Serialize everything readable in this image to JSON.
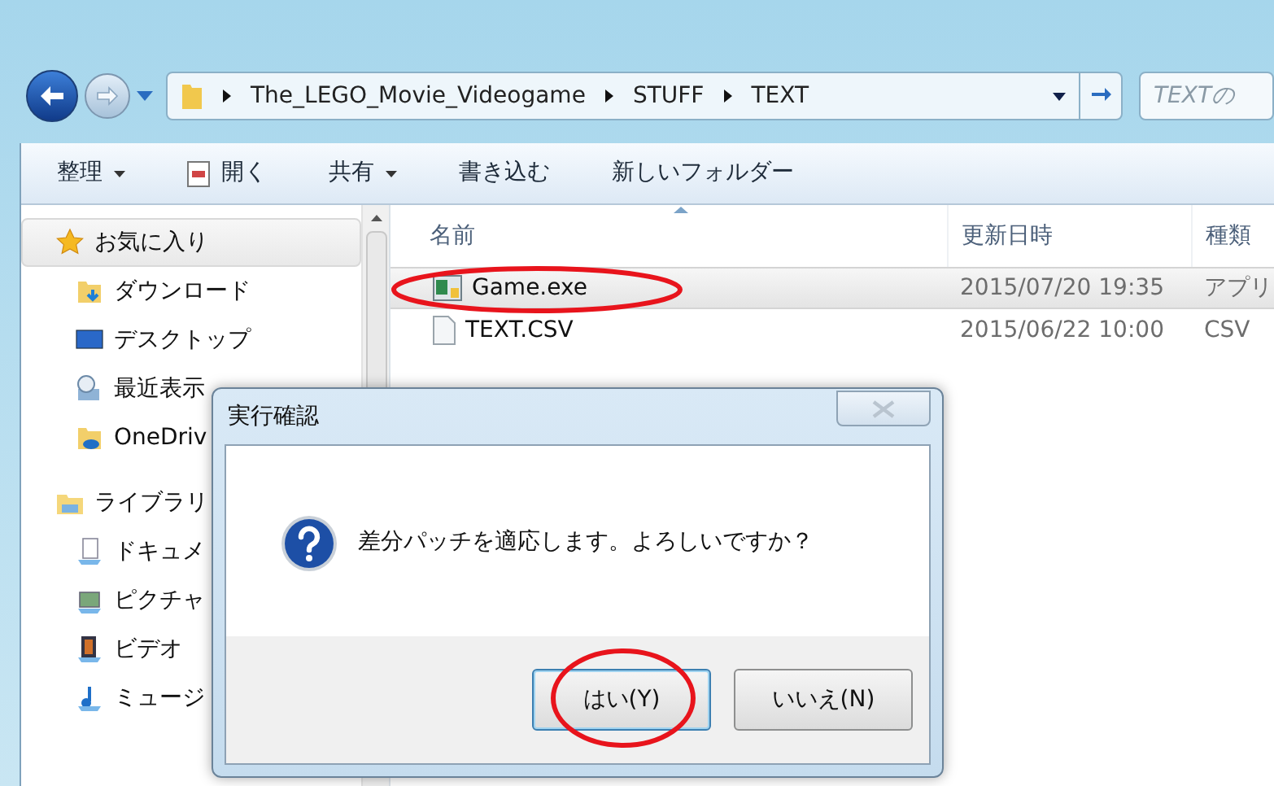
{
  "address_bar": {
    "path": [
      "The_LEGO_Movie_Videogame",
      "STUFF",
      "TEXT"
    ],
    "search": {
      "placeholder": "TEXTの"
    }
  },
  "toolbar": [
    {
      "label": "整理",
      "kind": "menu"
    },
    {
      "label": "開く",
      "kind": "icon"
    },
    {
      "label": "共有",
      "kind": "menu"
    },
    {
      "label": "書き込む",
      "kind": "plain"
    },
    {
      "label": "新しいフォルダー",
      "kind": "plain"
    }
  ],
  "sidebar": [
    {
      "label": "お気に入り",
      "kind": "star",
      "selected": true,
      "children": [
        {
          "label": "ダウンロード",
          "kind": "download",
          "selected": false
        },
        {
          "label": "デスクトップ",
          "kind": "desktop",
          "selected": false
        },
        {
          "label": "最近表示",
          "kind": "recent",
          "selected": false
        },
        {
          "label": "OneDriv",
          "kind": "cloud",
          "selected": false
        }
      ]
    },
    {
      "label": "ライブラリ",
      "kind": "library",
      "selected": false,
      "children": [
        {
          "label": "ドキュメ",
          "kind": "document",
          "selected": false
        },
        {
          "label": "ピクチャ",
          "kind": "pictures",
          "selected": false
        },
        {
          "label": "ビデオ",
          "kind": "video",
          "selected": false
        },
        {
          "label": "ミュージ",
          "kind": "music",
          "selected": false
        }
      ]
    }
  ],
  "file_list": {
    "columns": [
      "名前",
      "更新日時",
      "種類"
    ],
    "rows": [
      {
        "name": "Game.exe",
        "kind": "app",
        "modified": "2015/07/20 19:35",
        "type": "アプリ",
        "selected": true,
        "circled": true
      },
      {
        "name": "TEXT.CSV",
        "kind": "text",
        "modified": "2015/06/22 10:00",
        "type": "CSV",
        "selected": false,
        "circled": false
      }
    ]
  },
  "dialog": {
    "title": "実行確認",
    "message": "差分パッチを適応します。よろしいですか？",
    "buttons": [
      {
        "label": "はい(Y)",
        "selected": true,
        "circled": true
      },
      {
        "label": "いいえ(N)",
        "selected": false,
        "circled": false
      }
    ]
  }
}
